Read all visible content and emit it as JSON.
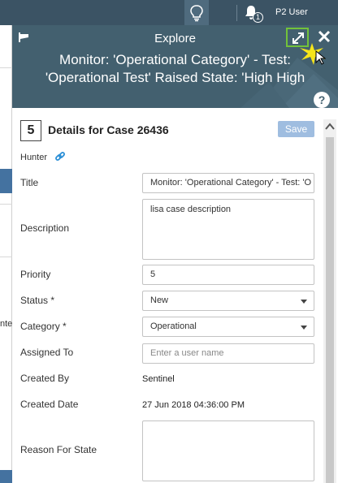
{
  "topbar": {
    "user_label": "P2 User",
    "notification_count": "1"
  },
  "background": {
    "left_fragment": "nte"
  },
  "panel": {
    "title": "Explore",
    "subtitle": "Monitor: 'Operational Category' - Test: 'Operational Test' Raised State: 'High High",
    "help_label": "?"
  },
  "case": {
    "number": "5",
    "title": "Details for Case 26436",
    "save_label": "Save",
    "hunter_label": "Hunter"
  },
  "form": {
    "title_label": "Title",
    "title_value": "Monitor: 'Operational Category' - Test: 'O",
    "description_label": "Description",
    "description_value": "lisa case description",
    "priority_label": "Priority",
    "priority_value": "5",
    "status_label": "Status *",
    "status_value": "New",
    "category_label": "Category *",
    "category_value": "Operational",
    "assigned_label": "Assigned To",
    "assigned_placeholder": "Enter a user name",
    "created_by_label": "Created By",
    "created_by_value": "Sentinel",
    "created_date_label": "Created Date",
    "created_date_value": "27 Jun 2018 04:36:00 PM",
    "reason_label": "Reason For State",
    "reason_value": ""
  },
  "icons": {
    "bulb": "lightbulb-icon",
    "bell": "bell-icon",
    "pin": "pin-icon",
    "expand": "expand-icon",
    "close": "close-icon",
    "help": "help-icon",
    "link": "link-icon"
  },
  "colors": {
    "topbar": "#3b5364",
    "panel_header": "#43606f",
    "highlight": "#72c23a",
    "save_button": "#9fbde0",
    "link": "#2b8fd6"
  }
}
